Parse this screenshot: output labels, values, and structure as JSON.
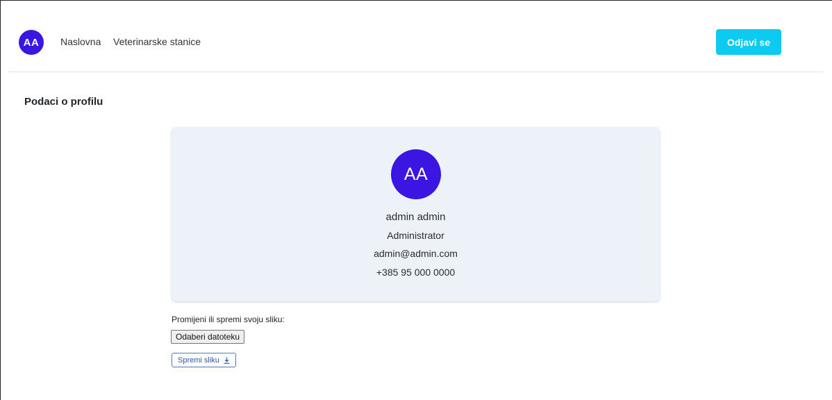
{
  "header": {
    "avatar_initials": "AA",
    "nav": [
      {
        "label": "Naslovna"
      },
      {
        "label": "Veterinarske stanice"
      }
    ],
    "logout_label": "Odjavi se"
  },
  "page": {
    "title": "Podaci o profilu"
  },
  "profile": {
    "initials": "AA",
    "name": "admin admin",
    "role": "Administrator",
    "email": "admin@admin.com",
    "phone": "+385 95 000 0000"
  },
  "upload": {
    "label": "Promijeni ili spremi svoju sliku:",
    "choose_file_label": "Odaberi datoteku",
    "save_label": "Spremi sliku",
    "save_icon": "download-icon"
  },
  "colors": {
    "avatar_bg": "#3b16e2",
    "logout_bg": "#0dcaf0",
    "card_bg": "#edf2f8",
    "save_border": "#4f79b8"
  }
}
